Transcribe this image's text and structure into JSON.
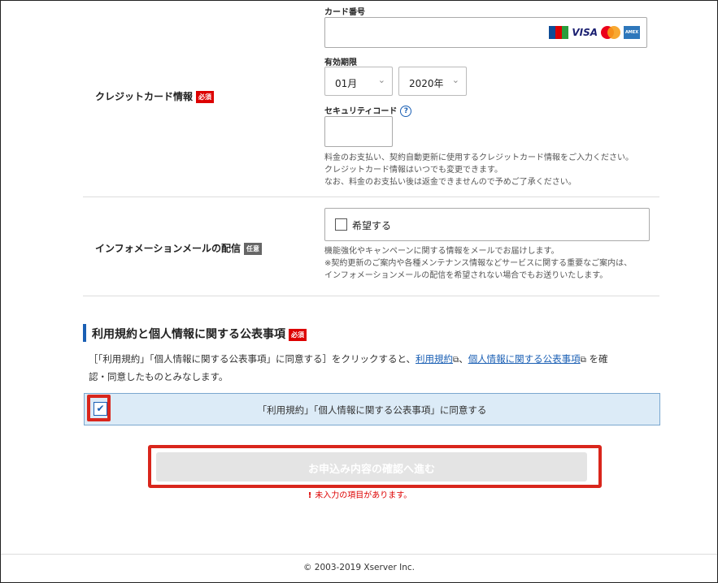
{
  "credit": {
    "section_label": "クレジットカード情報",
    "required_badge": "必須",
    "card_number_label": "カード番号",
    "card_brands": [
      "JCB",
      "VISA",
      "Mastercard",
      "AMEX"
    ],
    "visa_text": "VISA",
    "amex_text": "AMERICAN EXPRESS",
    "expiry_label": "有効期限",
    "expiry_month": "01月",
    "expiry_year": "2020年",
    "security_label": "セキュリティコード",
    "help_icon": "?",
    "note1": "料金のお支払い、契約自動更新に使用するクレジットカード情報をご入力ください。",
    "note2": "クレジットカード情報はいつでも変更できます。",
    "note3": "なお、料金のお支払い後は返金できませんので予めご了承ください。"
  },
  "info_mail": {
    "section_label": "インフォメーションメールの配信",
    "optional_badge": "任意",
    "checkbox_label": "希望する",
    "note1": "機能強化やキャンペーンに関する情報をメールでお届けします。",
    "note2": "※契約更新のご案内や各種メンテナンス情報などサービスに関する重要なご案内は、",
    "note3": "インフォメーションメールの配信を希望されない場合でもお送りいたします。"
  },
  "terms": {
    "heading": "利用規約と個人情報に関する公表事項",
    "required_badge": "必須",
    "desc_pre": "［「利用規約」「個人情報に関する公表事項」に同意する］をクリックすると、",
    "link_terms": "利用規約",
    "sep": "、",
    "link_privacy": "個人情報に関する公表事項",
    "desc_post": "を確",
    "desc_line2": "認・同意したものとみなします。",
    "agree_label": "「利用規約」「個人情報に関する公表事項」に同意する"
  },
  "submit": {
    "button_label": "お申込み内容の確認へ進む",
    "error_icon": "!",
    "error_text": "未入力の項目があります。"
  },
  "footer": {
    "copyright": "© 2003-2019 Xserver Inc."
  },
  "colors": {
    "required": "#dd0000",
    "highlight": "#d9261c",
    "agree_bg": "#dcebf7",
    "link": "#1a5fb4"
  }
}
